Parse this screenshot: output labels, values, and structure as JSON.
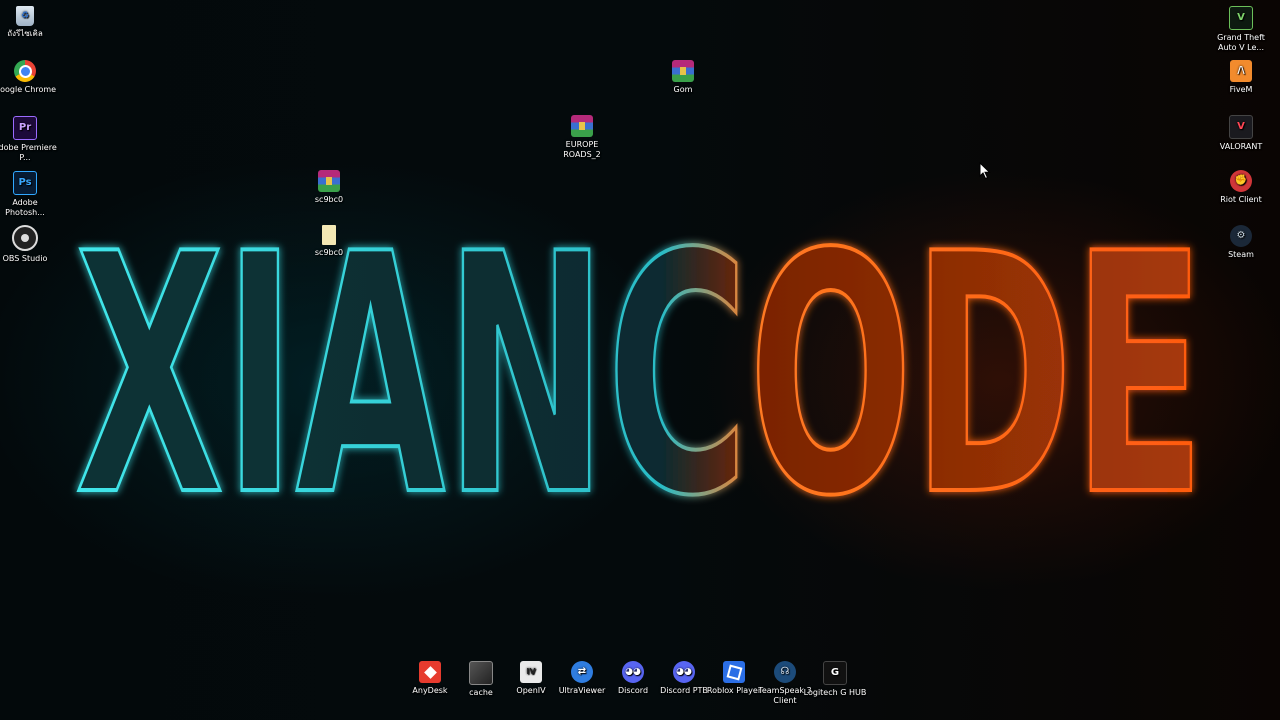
{
  "wallpaper": {
    "text": "XIANCODE",
    "colors": {
      "teal": "#38e1e6",
      "orange": "#ff6a1a"
    }
  },
  "desktop_icons_left": [
    {
      "label": "ถังรีไซเคิล",
      "icon": "recycle-bin-icon"
    },
    {
      "label": "Google Chrome",
      "icon": "chrome-icon"
    },
    {
      "label": "Adobe Premiere P...",
      "icon": "premiere-icon"
    },
    {
      "label": "Adobe Photosh...",
      "icon": "photoshop-icon"
    },
    {
      "label": "OBS Studio",
      "icon": "obs-icon"
    }
  ],
  "desktop_icons_middle": [
    {
      "label": "sc9bc0",
      "icon": "winrar-icon"
    },
    {
      "label": "sc9bc0",
      "icon": "file-icon"
    },
    {
      "label": "EUROPE ROADS_2",
      "icon": "winrar-icon"
    },
    {
      "label": "Gom",
      "icon": "winrar-icon"
    }
  ],
  "desktop_icons_right": [
    {
      "label": "Grand Theft Auto V Le...",
      "icon": "gta-icon"
    },
    {
      "label": "FiveM",
      "icon": "fivem-icon"
    },
    {
      "label": "VALORANT",
      "icon": "valorant-icon"
    },
    {
      "label": "Riot Client",
      "icon": "riot-icon"
    },
    {
      "label": "Steam",
      "icon": "steam-icon"
    }
  ],
  "desktop_icons_bottom": [
    {
      "label": "AnyDesk",
      "icon": "anydesk-icon"
    },
    {
      "label": "cache",
      "icon": "image-icon"
    },
    {
      "label": "OpenIV",
      "icon": "openiv-icon"
    },
    {
      "label": "UltraViewer",
      "icon": "ultraviewer-icon"
    },
    {
      "label": "Discord",
      "icon": "discord-icon"
    },
    {
      "label": "Discord PTB",
      "icon": "discord-icon"
    },
    {
      "label": "Roblox Player",
      "icon": "roblox-icon"
    },
    {
      "label": "TeamSpeak 3 Client",
      "icon": "teamspeak-icon"
    },
    {
      "label": "Logitech G HUB",
      "icon": "logitech-icon"
    }
  ]
}
